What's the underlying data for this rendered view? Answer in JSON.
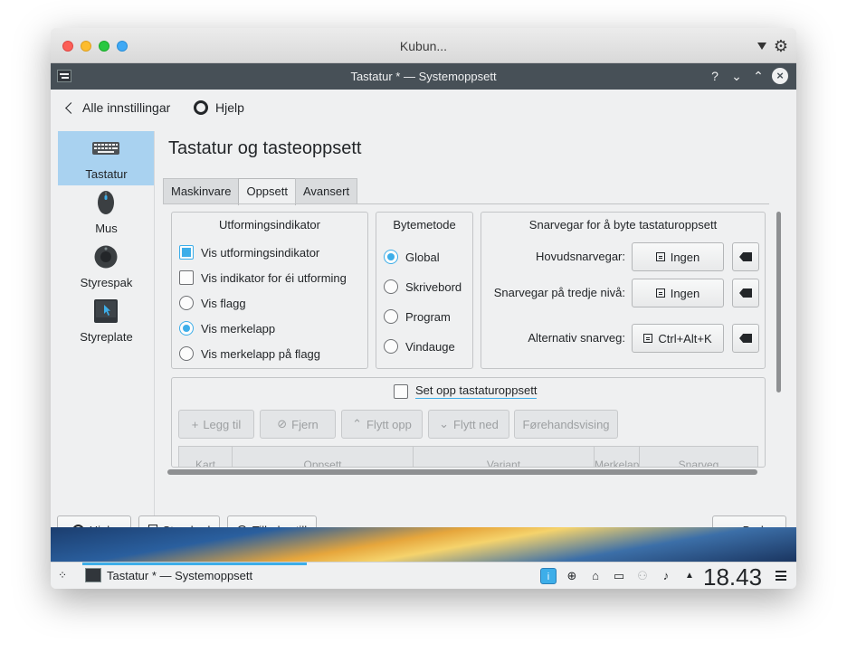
{
  "mac": {
    "title": "Kubun..."
  },
  "window": {
    "title": "Tastatur * — Systemoppsett",
    "buttons": {
      "help": "?",
      "minimize": "⌄",
      "maximize": "⌃",
      "close": "×"
    }
  },
  "topnav": {
    "back_label": "Alle innstillingar",
    "help_label": "Hjelp"
  },
  "sidebar": {
    "items": [
      {
        "label": "Tastatur",
        "icon": "keyboard-icon"
      },
      {
        "label": "Mus",
        "icon": "mouse-icon"
      },
      {
        "label": "Styrespak",
        "icon": "joystick-icon"
      },
      {
        "label": "Styreplate",
        "icon": "touchpad-icon"
      }
    ]
  },
  "page": {
    "title": "Tastatur og tasteoppsett"
  },
  "tabs": [
    "Maskinvare",
    "Oppsett",
    "Avansert"
  ],
  "indicator": {
    "title": "Utformingsindikator",
    "options": [
      {
        "label": "Vis utformingsindikator",
        "checked": true
      },
      {
        "label": "Vis indikator for éi utforming",
        "checked": false
      },
      {
        "label": "Vis flagg",
        "checked": false
      },
      {
        "label": "Vis merkelapp",
        "checked": true
      },
      {
        "label": "Vis merkelapp på flagg",
        "checked": false
      }
    ]
  },
  "switching": {
    "title": "Bytemetode",
    "options": [
      {
        "label": "Global",
        "checked": true
      },
      {
        "label": "Skrivebord",
        "checked": false
      },
      {
        "label": "Program",
        "checked": false
      },
      {
        "label": "Vindauge",
        "checked": false
      }
    ]
  },
  "shortcuts": {
    "title": "Snarvegar for å byte tastaturoppsett",
    "rows": [
      {
        "label": "Hovudsnarvegar:",
        "value": "Ingen"
      },
      {
        "label": "Snarvegar på tredje nivå:",
        "value": "Ingen"
      },
      {
        "label": "Alternativ snarveg:",
        "value": "Ctrl+Alt+K"
      }
    ]
  },
  "layouts": {
    "setup_label": "Set opp tastaturoppsett",
    "buttons": {
      "add": "Legg til",
      "remove": "Fjern",
      "up": "Flytt opp",
      "down": "Flytt ned",
      "preview": "Førehandsvising"
    },
    "columns": [
      "Kart",
      "Oppsett",
      "Variant",
      "Merkelapp",
      "Snarveg"
    ]
  },
  "footer": {
    "help": "Hjelp",
    "defaults": "Standard",
    "reset": "Tilbakestill",
    "apply": "Bruk"
  },
  "taskbar": {
    "task_title": "Tastatur * — Systemoppsett",
    "clock": "18.43"
  },
  "colors": {
    "accent": "#3daee9",
    "titlebar": "#475057",
    "window_bg": "#eff0f1",
    "selected_sidebar": "#a9d2f0"
  }
}
